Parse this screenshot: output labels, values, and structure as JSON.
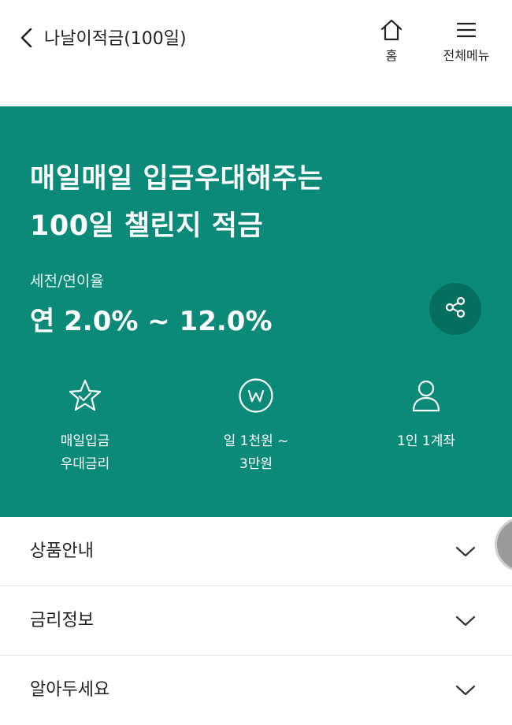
{
  "header": {
    "title": "나날이적금(100일)",
    "home_label": "홈",
    "menu_label": "전체메뉴",
    "icons": {
      "back": "chevron-left-icon",
      "home": "home-icon",
      "menu": "hamburger-menu-icon"
    }
  },
  "hero": {
    "headline_line1": "매일매일 입금우대해주는",
    "headline_line2": "100일 챌린지 적금",
    "rate_label": "세전/연이율",
    "rate_value": "연 2.0% ~ 12.0%",
    "background_color": "#0b8a78",
    "share_button_color": "#06705f",
    "features": [
      {
        "icon": "star-icon",
        "line1": "매일입금",
        "line2": "우대금리"
      },
      {
        "icon": "won-coin-icon",
        "line1": "일 1천원 ~",
        "line2": "3만원"
      },
      {
        "icon": "person-icon",
        "line1": "1인 1계좌",
        "line2": ""
      }
    ]
  },
  "accordion": {
    "items": [
      {
        "label": "상품안내"
      },
      {
        "label": "금리정보"
      },
      {
        "label": "알아두세요"
      }
    ]
  }
}
